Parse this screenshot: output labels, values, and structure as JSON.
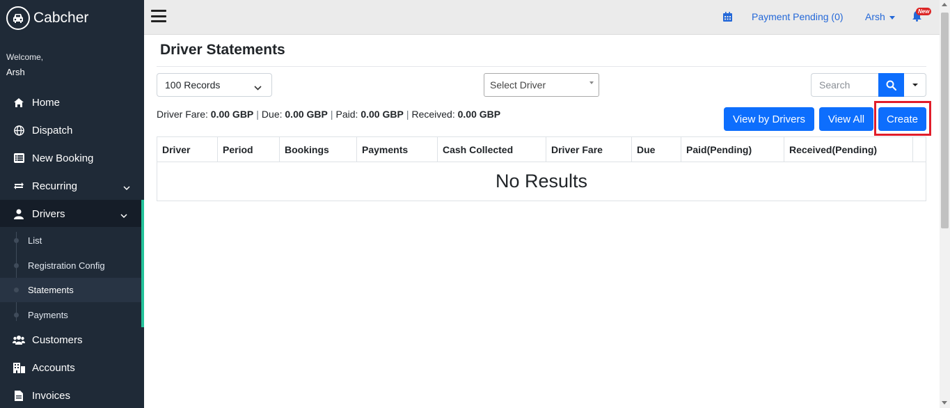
{
  "brand": {
    "name": "Cabcher",
    "logo_icon": "car-icon"
  },
  "sidebar": {
    "welcome": "Welcome,",
    "username": "Arsh",
    "items": [
      {
        "label": "Home",
        "icon": "home-icon"
      },
      {
        "label": "Dispatch",
        "icon": "globe-icon"
      },
      {
        "label": "New Booking",
        "icon": "list-icon"
      },
      {
        "label": "Recurring",
        "icon": "repeat-icon"
      },
      {
        "label": "Drivers",
        "icon": "driver-icon"
      },
      {
        "label": "Customers",
        "icon": "users-icon"
      },
      {
        "label": "Accounts",
        "icon": "building-icon"
      },
      {
        "label": "Invoices",
        "icon": "file-icon"
      }
    ],
    "drivers_submenu": [
      {
        "label": "List"
      },
      {
        "label": "Registration Config"
      },
      {
        "label": "Statements",
        "active": true
      },
      {
        "label": "Payments"
      }
    ]
  },
  "topbar": {
    "payment_pending": "Payment Pending (0)",
    "user": "Arsh",
    "badge": "New"
  },
  "main": {
    "title": "Driver Statements",
    "records_select": "100 Records",
    "driver_select": "Select Driver",
    "search_placeholder": "Search",
    "summary": {
      "driver_fare_label": "Driver Fare:",
      "driver_fare_value": "0.00 GBP",
      "due_label": "Due:",
      "due_value": "0.00 GBP",
      "paid_label": "Paid:",
      "paid_value": "0.00 GBP",
      "received_label": "Received:",
      "received_value": "0.00 GBP"
    },
    "buttons": {
      "view_by_drivers": "View by Drivers",
      "view_all": "View All",
      "create": "Create"
    },
    "table": {
      "columns": [
        "Driver",
        "Period",
        "Bookings",
        "Payments",
        "Cash Collected",
        "Driver Fare",
        "Due",
        "Paid(Pending)",
        "Received(Pending)"
      ],
      "empty_text": "No Results"
    }
  },
  "colors": {
    "sidebar_bg": "#1f2a37",
    "accent": "#0d6efd",
    "active_border": "#24c29a",
    "highlight": "#e11d2a"
  }
}
